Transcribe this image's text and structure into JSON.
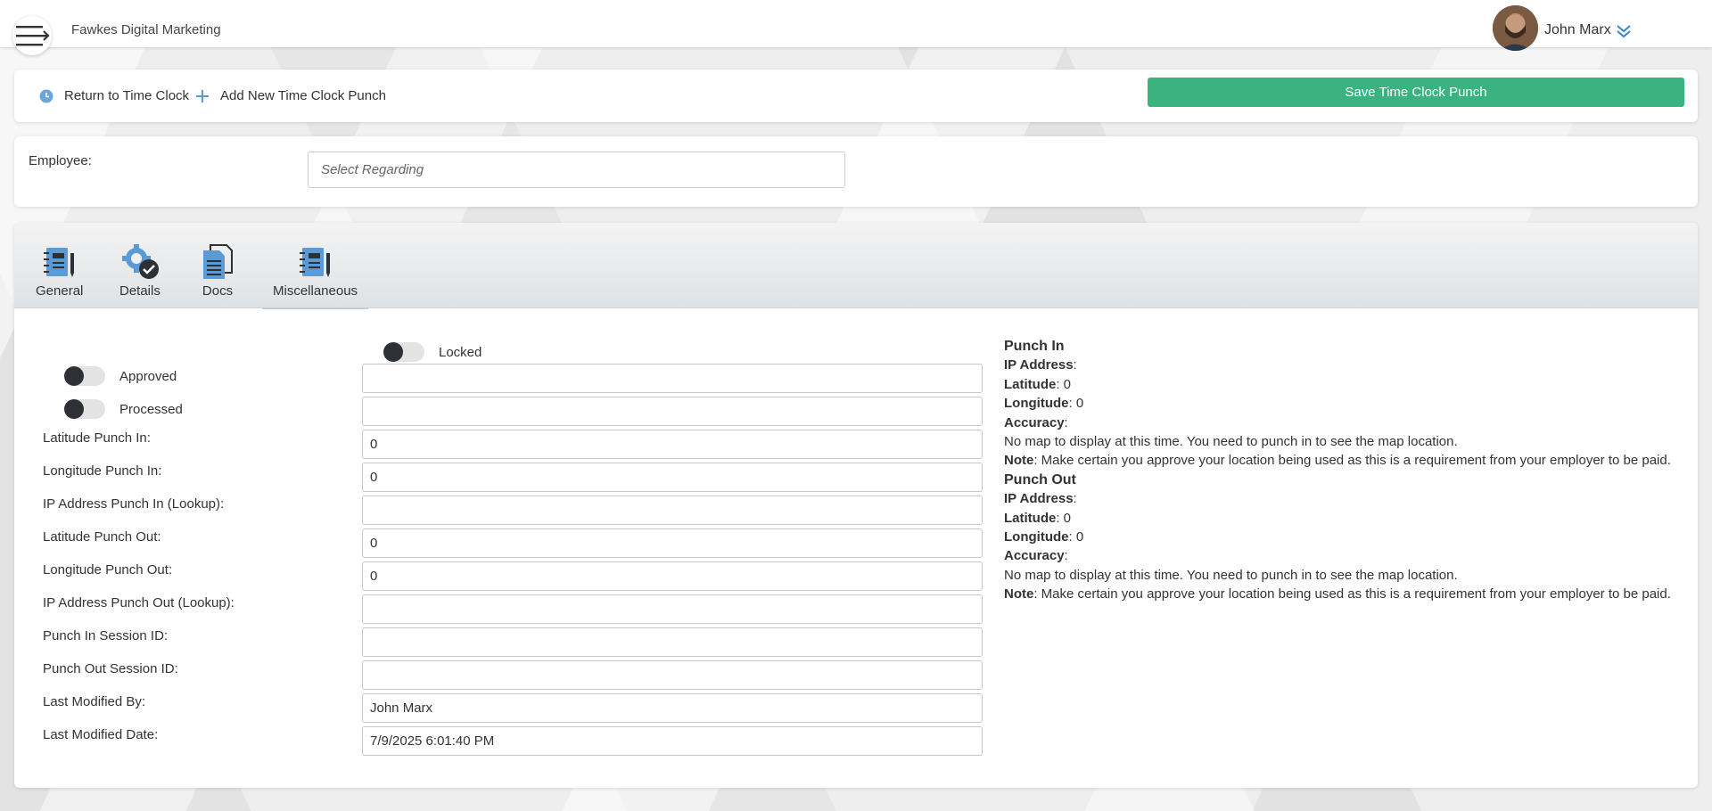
{
  "header": {
    "company": "Fawkes Digital Marketing",
    "user_name": "John Marx"
  },
  "actions": {
    "return_label": "Return to Time Clock",
    "add_label": "Add New Time Clock Punch",
    "save_label": "Save Time Clock Punch"
  },
  "employee": {
    "label": "Employee:",
    "placeholder": "Select Regarding"
  },
  "tabs": [
    {
      "label": "General",
      "icon": "notebook-icon"
    },
    {
      "label": "Details",
      "icon": "gear-check-icon"
    },
    {
      "label": "Docs",
      "icon": "documents-icon"
    },
    {
      "label": "Miscellaneous",
      "icon": "notebook-icon"
    }
  ],
  "switches": {
    "locked": "Locked",
    "approved": "Approved",
    "processed": "Processed"
  },
  "fields": [
    {
      "label": "Latitude Punch In:",
      "value": "0"
    },
    {
      "label": "Longitude Punch In:",
      "value": "0"
    },
    {
      "label": "IP Address Punch In (Lookup):",
      "value": ""
    },
    {
      "label": "Latitude Punch Out:",
      "value": "0"
    },
    {
      "label": "Longitude Punch Out:",
      "value": "0"
    },
    {
      "label": "IP Address Punch Out (Lookup):",
      "value": ""
    },
    {
      "label": "Punch In Session ID:",
      "value": ""
    },
    {
      "label": "Punch Out Session ID:",
      "value": ""
    },
    {
      "label": "Last Modified By:",
      "value": "John Marx"
    },
    {
      "label": "Last Modified Date:",
      "value": "7/9/2025 6:01:40 PM"
    }
  ],
  "punch_in": {
    "title": "Punch In",
    "ip_label": "IP Address",
    "ip_value": ":",
    "lat_label": "Latitude",
    "lat_value": ": 0",
    "lng_label": "Longitude",
    "lng_value": ": 0",
    "acc_label": "Accuracy",
    "acc_value": ":",
    "map_msg": "No map to display at this time. You need to punch in to see the map location.",
    "note_label": "Note",
    "note_text": ": Make certain you approve your location being used as this is a requirement from your employer to be paid."
  },
  "punch_out": {
    "title": "Punch Out",
    "ip_label": "IP Address",
    "ip_value": ":",
    "lat_label": "Latitude",
    "lat_value": ": 0",
    "lng_label": "Longitude",
    "lng_value": ": 0",
    "acc_label": "Accuracy",
    "acc_value": ":",
    "map_msg": "No map to display at this time. You need to punch in to see the map location.",
    "note_label": "Note",
    "note_text": ": Make certain you approve your location being used as this is a requirement from your employer to be paid."
  },
  "colors": {
    "save_button": "#3bb380",
    "icon_blue": "#5b9bd5",
    "switch_knob": "#2d3136"
  }
}
